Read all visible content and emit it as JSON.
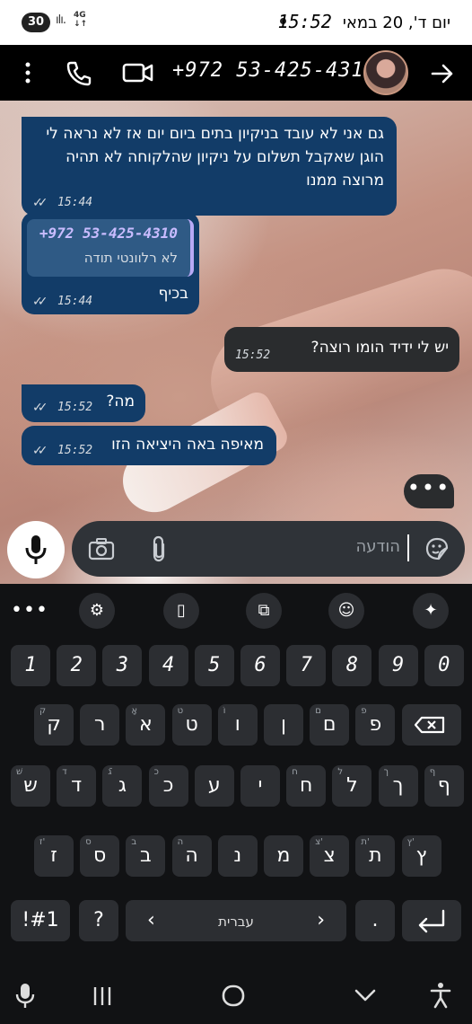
{
  "status": {
    "battery": "30",
    "signal": "ılı.",
    "network": "4G\n↓↑",
    "time": "15:52",
    "date": "יום ד', 20 במאי"
  },
  "header": {
    "contact": "+972 53-425-4310",
    "icons": [
      "more-vert-icon",
      "phone-icon",
      "video-icon",
      "avatar",
      "arrow-right-icon"
    ]
  },
  "messages": [
    {
      "direction": "in",
      "text": "גם אני לא עובד בניקיון בתים ביום יום אז לא נראה לי הוגן שאקבל תשלום על ניקיון שהלקוחה לא תהיה מרוצה ממנו",
      "time": "15:44",
      "status": "read"
    },
    {
      "direction": "in",
      "quote_sender": "+972 53-425-4310",
      "quote_text": "לא רלוונטי תודה",
      "text": "בכיף",
      "time": "15:44",
      "status": "read"
    },
    {
      "direction": "out",
      "text": "יש לי ידיד הומו רוצה?",
      "time": "15:52"
    },
    {
      "direction": "in",
      "text": "מה?",
      "time": "15:52",
      "status": "read"
    },
    {
      "direction": "in",
      "text": "מאיפה באה היציאה הזו",
      "time": "15:52",
      "status": "read"
    }
  ],
  "typing_indicator": "•••",
  "input": {
    "placeholder": "הודעה",
    "icons": [
      "mic-icon",
      "camera-icon",
      "paperclip-icon",
      "sticker-icon"
    ]
  },
  "keyboard": {
    "toolbar": [
      "more-icon",
      "settings-icon",
      "clipboard-icon",
      "translate-icon",
      "emoji-icon",
      "ai-sparkle-icon"
    ],
    "numbers": [
      "1",
      "2",
      "3",
      "4",
      "5",
      "6",
      "7",
      "8",
      "9",
      "0"
    ],
    "row1": [
      {
        "k": "ק",
        "s": "ק"
      },
      {
        "k": "ר",
        "s": ""
      },
      {
        "k": "א",
        "s": "אָ"
      },
      {
        "k": "ט",
        "s": "ט"
      },
      {
        "k": "ו",
        "s": "וֹ"
      },
      {
        "k": "ן",
        "s": ""
      },
      {
        "k": "ם",
        "s": "ם"
      },
      {
        "k": "פ",
        "s": "פ"
      }
    ],
    "row2": [
      {
        "k": "ש",
        "s": "שׁ"
      },
      {
        "k": "ד",
        "s": "ד"
      },
      {
        "k": "ג",
        "s": "גֿ"
      },
      {
        "k": "כ",
        "s": "כ"
      },
      {
        "k": "ע",
        "s": ""
      },
      {
        "k": "י",
        "s": ""
      },
      {
        "k": "ח",
        "s": "ח"
      },
      {
        "k": "ל",
        "s": "ל"
      },
      {
        "k": "ך",
        "s": "ך"
      },
      {
        "k": "ף",
        "s": "ף"
      }
    ],
    "row3": [
      {
        "k": "ז",
        "s": "ז'"
      },
      {
        "k": "ס",
        "s": "ס"
      },
      {
        "k": "ב",
        "s": "ב"
      },
      {
        "k": "ה",
        "s": "ה"
      },
      {
        "k": "נ",
        "s": ""
      },
      {
        "k": "מ",
        "s": ""
      },
      {
        "k": "צ",
        "s": "צ'"
      },
      {
        "k": "ת",
        "s": "ת'"
      },
      {
        "k": "ץ",
        "s": "ץ'"
      }
    ],
    "symbols": "!#1",
    "question": "?",
    "language": "עברית",
    "space_left": "‹",
    "space_right": "›",
    "period": ".",
    "enter": "↵"
  },
  "nav": [
    "mic-icon",
    "recents-icon",
    "home-icon",
    "back-chevron-icon",
    "accessibility-icon"
  ]
}
